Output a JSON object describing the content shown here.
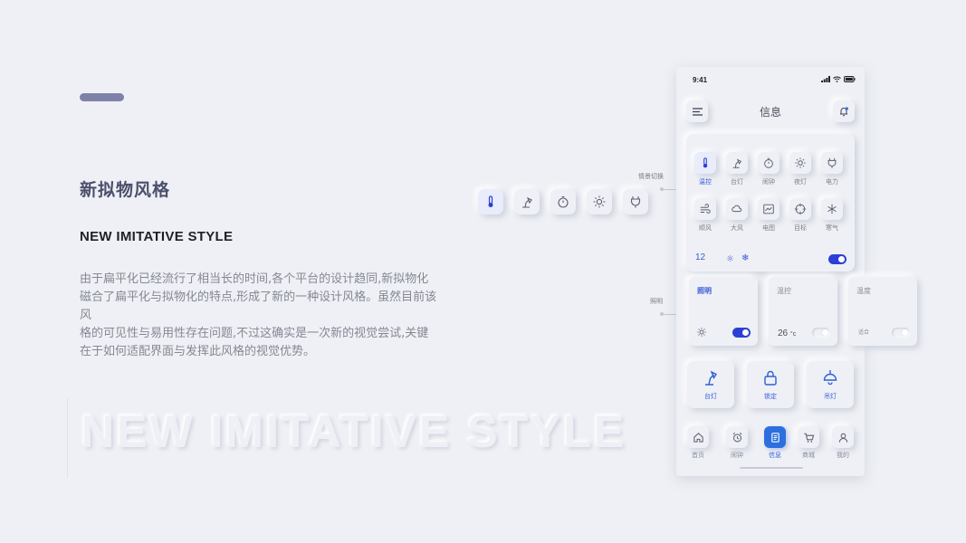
{
  "colors": {
    "accent": "#2c3fd6",
    "background": "#eef0f5",
    "bar": "#7f82a8",
    "label_blue": "#3a5ad9"
  },
  "intro": {
    "title_cn": "新拟物风格",
    "title_en": "NEW IMITATIVE STYLE",
    "description": [
      "由于扁平化已经流行了相当长的时间,各个平台的设计趋同,新拟物化",
      "磁合了扁平化与拟物化的特点,形成了新的一种设计风格。虽然目前该",
      "风",
      "格的可见性与易用性存在问题,不过这确实是一次新的视觉尝试,关键",
      "在于如何适配界面与发挥此风格的视觉优势。"
    ],
    "watermark": "NEW IMITATIVE STYLE"
  },
  "annotations": {
    "scene_switch": "情景切换",
    "lighting": "照明"
  },
  "floating_icons": [
    "thermometer-icon",
    "desk-lamp-icon",
    "timer-icon",
    "sun-icon",
    "plug-icon"
  ],
  "phone": {
    "status": {
      "time": "9:41"
    },
    "header": {
      "title": "信息"
    },
    "scenes": [
      {
        "label": "温控",
        "icon": "thermometer-icon",
        "active": true
      },
      {
        "label": "台灯",
        "icon": "desk-lamp-icon"
      },
      {
        "label": "闹钟",
        "icon": "timer-icon"
      },
      {
        "label": "夜灯",
        "icon": "sun-icon"
      },
      {
        "label": "电力",
        "icon": "plug-icon"
      },
      {
        "label": "顺风",
        "icon": "wind-icon"
      },
      {
        "label": "大风",
        "icon": "cloud-icon"
      },
      {
        "label": "电图",
        "icon": "chart-icon"
      },
      {
        "label": "目标",
        "icon": "target-icon"
      },
      {
        "label": "寒气",
        "icon": "snowflake-icon"
      }
    ],
    "scene_footer": {
      "number": "12",
      "sun": "☼",
      "snow": "❄",
      "toggle_on": true
    },
    "cards": [
      {
        "title": "照明",
        "toggle_on": true
      },
      {
        "title": "温控",
        "value": "26",
        "unit": "°c",
        "toggle_on": false
      },
      {
        "title": "温度",
        "sub": "适合",
        "toggle_on": false
      }
    ],
    "quick_actions": [
      {
        "label": "台灯",
        "icon": "desk-lamp-icon"
      },
      {
        "label": "锁定",
        "icon": "lock-icon"
      },
      {
        "label": "吊灯",
        "icon": "pendant-lamp-icon"
      }
    ],
    "tabs": [
      {
        "label": "首页",
        "icon": "home-icon"
      },
      {
        "label": "闹钟",
        "icon": "alarm-clock-icon"
      },
      {
        "label": "信息",
        "icon": "document-icon",
        "active": true
      },
      {
        "label": "商城",
        "icon": "cart-icon"
      },
      {
        "label": "我的",
        "icon": "user-icon"
      }
    ]
  }
}
